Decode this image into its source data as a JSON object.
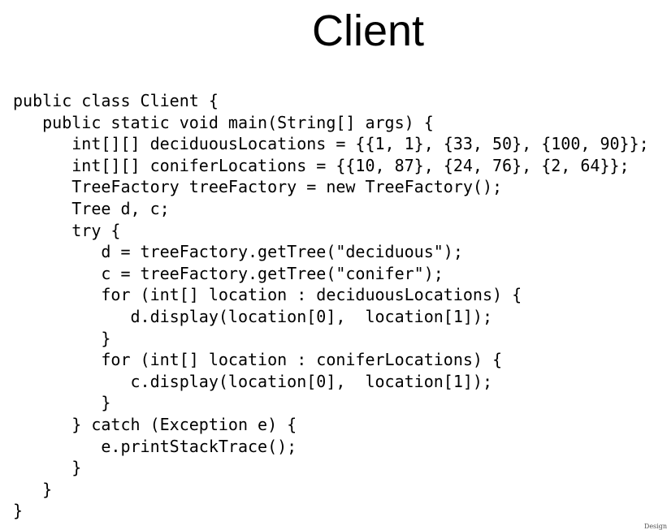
{
  "slide": {
    "title": "Client",
    "footer": "Design",
    "code_lines": [
      "public class Client {",
      "   public static void main(String[] args) {",
      "      int[][] deciduousLocations = {{1, 1}, {33, 50}, {100, 90}};",
      "      int[][] coniferLocations = {{10, 87}, {24, 76}, {2, 64}};",
      "      TreeFactory treeFactory = new TreeFactory();",
      "      Tree d, c;",
      "      try {",
      "         d = treeFactory.getTree(\"deciduous\");",
      "         c = treeFactory.getTree(\"conifer\");",
      "         for (int[] location : deciduousLocations) {",
      "            d.display(location[0],  location[1]);",
      "         }",
      "         for (int[] location : coniferLocations) {",
      "            c.display(location[0],  location[1]);",
      "         }",
      "      } catch (Exception e) {",
      "         e.printStackTrace();",
      "      }",
      "   }",
      "}"
    ]
  }
}
